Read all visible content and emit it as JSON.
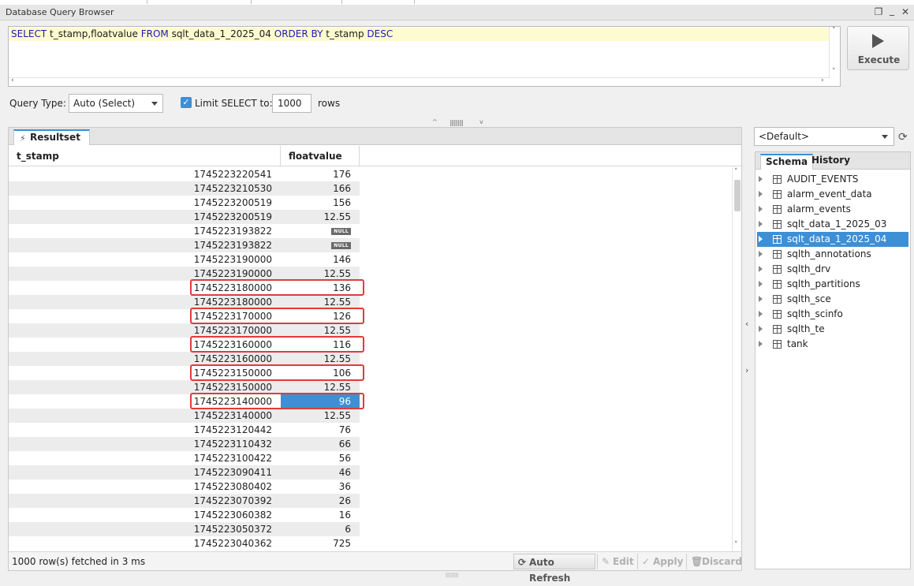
{
  "window": {
    "title": "Database Query Browser",
    "controls": {
      "restore": "❐",
      "minimize": "_",
      "close": "✕"
    }
  },
  "editor": {
    "query_tokens": [
      {
        "t": "SELECT",
        "kw": true
      },
      {
        "t": " t_stamp,floatvalue ",
        "kw": false
      },
      {
        "t": "FROM",
        "kw": true
      },
      {
        "t": " sqlt_data_1_2025_04 ",
        "kw": false
      },
      {
        "t": "ORDER BY",
        "kw": true
      },
      {
        "t": " t_stamp ",
        "kw": false
      },
      {
        "t": "DESC",
        "kw": true
      }
    ],
    "execute_label": "Execute"
  },
  "options": {
    "query_type_label": "Query Type:",
    "query_type_value": "Auto (Select)",
    "limit_label": "Limit SELECT to:",
    "limit_checked": true,
    "limit_value": "1000",
    "rows_label": "rows"
  },
  "results": {
    "tab_label": "Resultset 1",
    "columns": [
      "t_stamp",
      "floatvalue"
    ],
    "rows": [
      [
        "1745223220541",
        "176"
      ],
      [
        "1745223210530",
        "166"
      ],
      [
        "1745223200519",
        "156"
      ],
      [
        "1745223200519",
        "12.55"
      ],
      [
        "1745223193822",
        "NULL"
      ],
      [
        "1745223193822",
        "NULL"
      ],
      [
        "1745223190000",
        "146"
      ],
      [
        "1745223190000",
        "12.55"
      ],
      [
        "1745223180000",
        "136"
      ],
      [
        "1745223180000",
        "12.55"
      ],
      [
        "1745223170000",
        "126"
      ],
      [
        "1745223170000",
        "12.55"
      ],
      [
        "1745223160000",
        "116"
      ],
      [
        "1745223160000",
        "12.55"
      ],
      [
        "1745223150000",
        "106"
      ],
      [
        "1745223150000",
        "12.55"
      ],
      [
        "1745223140000",
        "96"
      ],
      [
        "1745223140000",
        "12.55"
      ],
      [
        "1745223120442",
        "76"
      ],
      [
        "1745223110432",
        "66"
      ],
      [
        "1745223100422",
        "56"
      ],
      [
        "1745223090411",
        "46"
      ],
      [
        "1745223080402",
        "36"
      ],
      [
        "1745223070392",
        "26"
      ],
      [
        "1745223060382",
        "16"
      ],
      [
        "1745223050372",
        "6"
      ],
      [
        "1745223040362",
        "725"
      ]
    ],
    "selected_row": 16,
    "highlighted_rows": [
      8,
      10,
      12,
      14,
      16
    ],
    "status": "1000 row(s) fetched in 3 ms",
    "buttons": {
      "auto_refresh": "Auto Refresh",
      "edit": "Edit",
      "apply": "Apply",
      "discard": "Discard"
    }
  },
  "schema": {
    "datasource": "<Default>",
    "tabs": [
      "Schema",
      "History"
    ],
    "active_tab": "Schema",
    "tables": [
      "AUDIT_EVENTS",
      "alarm_event_data",
      "alarm_events",
      "sqlt_data_1_2025_03",
      "sqlt_data_1_2025_04",
      "sqlth_annotations",
      "sqlth_drv",
      "sqlth_partitions",
      "sqlth_sce",
      "sqlth_scinfo",
      "sqlth_te",
      "tank"
    ],
    "selected_table": 4
  },
  "colors": {
    "accent": "#3d8fd6",
    "highlight_box": "#e23b3b",
    "keyword": "#1b1bb5",
    "editor_line": "#fffbd0"
  }
}
